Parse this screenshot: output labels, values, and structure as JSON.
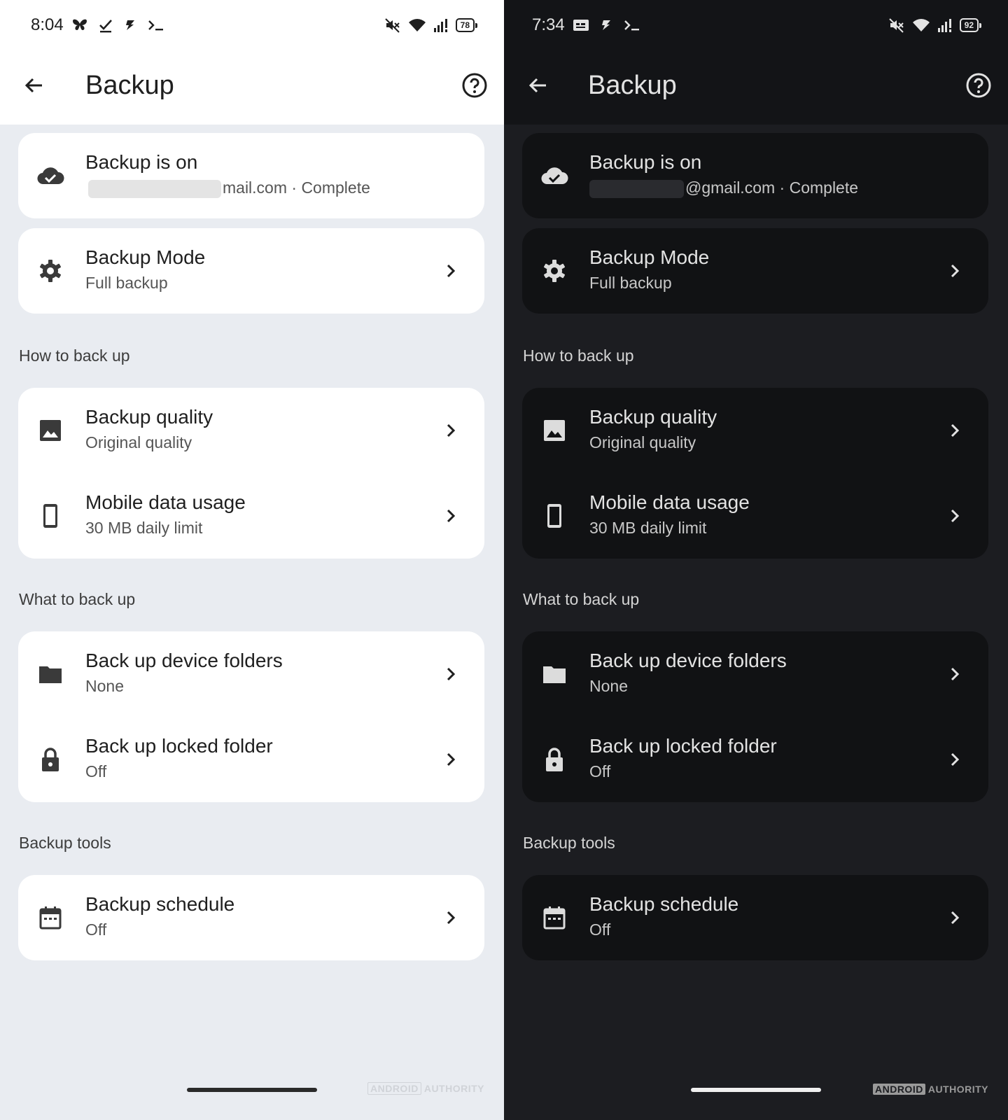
{
  "watermark": {
    "brand": "ANDROID",
    "suffix": "AUTHORITY"
  },
  "panels": [
    {
      "theme": "light",
      "status": {
        "time": "8:04",
        "battery": "78"
      },
      "appbar": {
        "title": "Backup"
      },
      "backup_status": {
        "title": "Backup is on",
        "account": "mail.com · Complete"
      },
      "backup_mode": {
        "title": "Backup Mode",
        "value": "Full backup"
      },
      "section_how": "How to back up",
      "backup_quality": {
        "title": "Backup quality",
        "value": "Original quality"
      },
      "mobile_data": {
        "title": "Mobile data usage",
        "value": "30 MB daily limit"
      },
      "section_what": "What to back up",
      "device_folders": {
        "title": "Back up device folders",
        "value": "None"
      },
      "locked_folder": {
        "title": "Back up locked folder",
        "value": "Off"
      },
      "section_tools": "Backup tools",
      "schedule": {
        "title": "Backup schedule",
        "value": "Off"
      }
    },
    {
      "theme": "dark",
      "status": {
        "time": "7:34",
        "battery": "92"
      },
      "appbar": {
        "title": "Backup"
      },
      "backup_status": {
        "title": "Backup is on",
        "account": "@gmail.com · Complete"
      },
      "backup_mode": {
        "title": "Backup Mode",
        "value": "Full backup"
      },
      "section_how": "How to back up",
      "backup_quality": {
        "title": "Backup quality",
        "value": "Original quality"
      },
      "mobile_data": {
        "title": "Mobile data usage",
        "value": "30 MB daily limit"
      },
      "section_what": "What to back up",
      "device_folders": {
        "title": "Back up device folders",
        "value": "None"
      },
      "locked_folder": {
        "title": "Back up locked folder",
        "value": "Off"
      },
      "section_tools": "Backup tools",
      "schedule": {
        "title": "Backup schedule",
        "value": "Off"
      }
    }
  ],
  "icons": {
    "status_left_light": [
      "butterfly-icon",
      "download-done-icon",
      "bolt-app-icon",
      "terminal-icon"
    ],
    "status_left_dark": [
      "message-icon",
      "bolt-app-icon",
      "terminal-icon"
    ],
    "status_right": [
      "mute-icon",
      "wifi-icon",
      "signal-icon",
      "battery-icon"
    ],
    "rows": [
      "cloud-done-icon",
      "gear-icon",
      "image-icon",
      "phone-icon",
      "folder-icon",
      "lock-icon",
      "calendar-icon",
      "chevron-right-icon",
      "arrow-back-icon",
      "help-icon"
    ]
  }
}
